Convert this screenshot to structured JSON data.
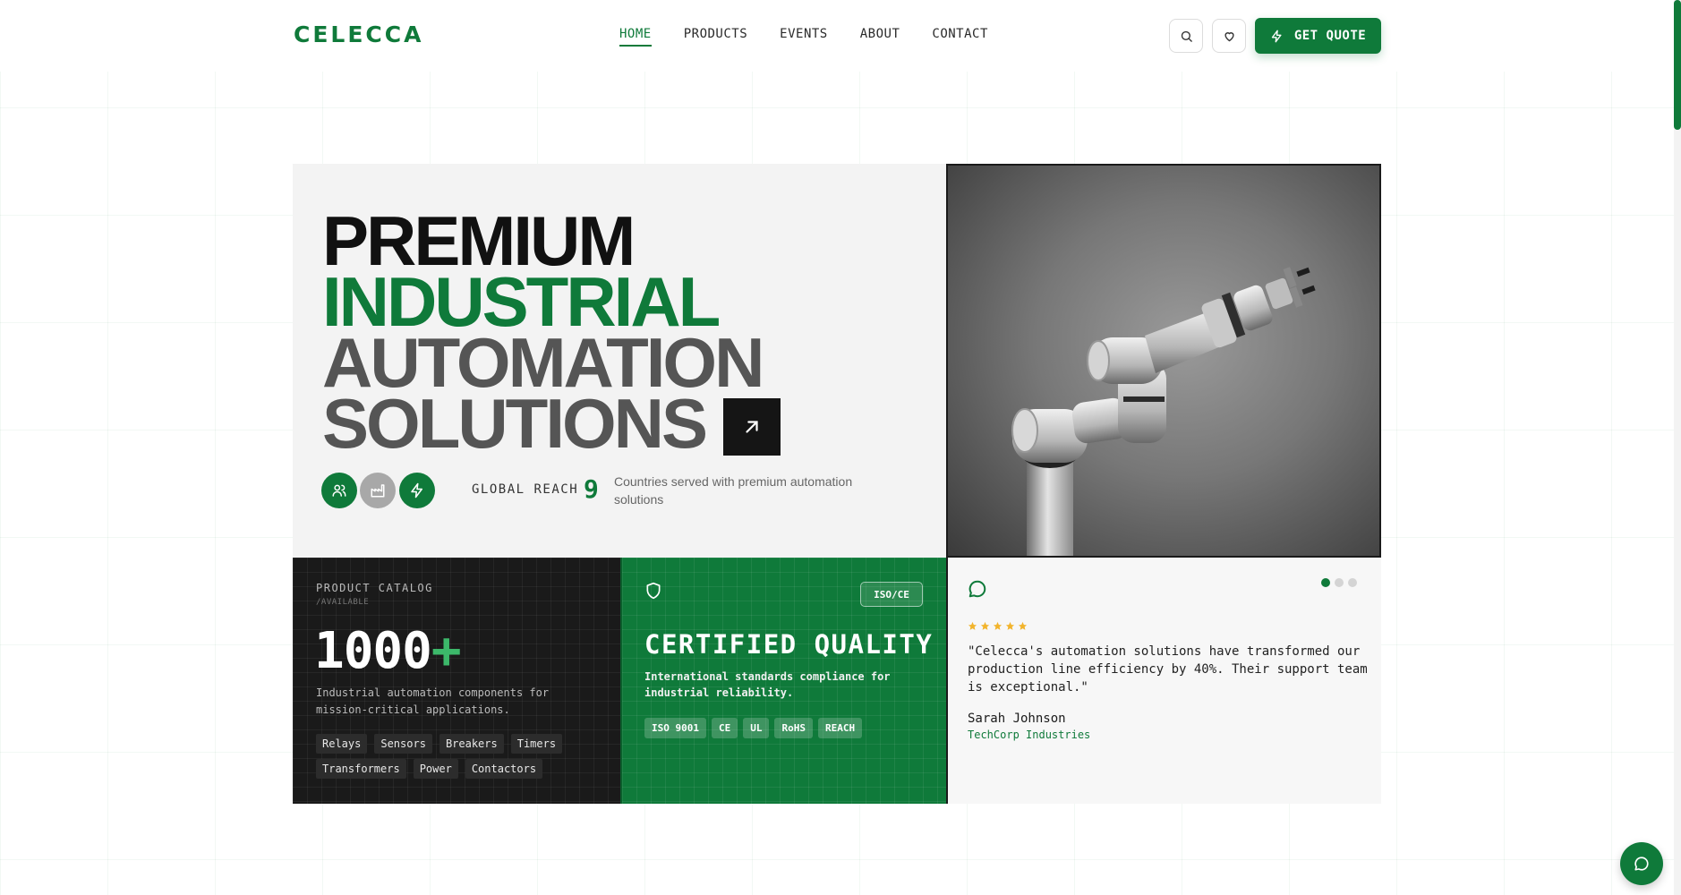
{
  "brand": {
    "logo": "CELECCA",
    "accent_color": "#0f7a3a"
  },
  "nav": {
    "items": [
      {
        "label": "HOME",
        "active": true
      },
      {
        "label": "PRODUCTS",
        "active": false
      },
      {
        "label": "EVENTS",
        "active": false
      },
      {
        "label": "ABOUT",
        "active": false
      },
      {
        "label": "CONTACT",
        "active": false
      }
    ],
    "search_icon": "search-icon",
    "wishlist_icon": "heart-icon",
    "quote_button": {
      "label": "GET QUOTE",
      "icon": "bolt-icon"
    }
  },
  "hero": {
    "headline": [
      "PREMIUM",
      "INDUSTRIAL",
      "AUTOMATION",
      "SOLUTIONS"
    ],
    "arrow_icon": "arrow-up-right-icon",
    "feature_icons": [
      "users-icon",
      "factory-icon",
      "bolt-icon"
    ],
    "reach_label": "GLOBAL REACH",
    "reach_number": "9",
    "reach_description": "Countries served with premium automation solutions",
    "image_subject": "robotic-arm-photo"
  },
  "catalog_card": {
    "label": "PRODUCT CATALOG",
    "sublabel": "/AVAILABLE",
    "count": "1000",
    "count_suffix": "+",
    "description": "Industrial automation components for mission-critical applications.",
    "tags": [
      "Relays",
      "Sensors",
      "Breakers",
      "Timers",
      "Transformers",
      "Power",
      "Contactors"
    ]
  },
  "quality_card": {
    "badge": "ISO/CE",
    "icon": "shield-icon",
    "title": "CERTIFIED QUALITY",
    "description": "International standards compliance for industrial reliability.",
    "certifications": [
      "ISO 9001",
      "CE",
      "UL",
      "RoHS",
      "REACH"
    ]
  },
  "testimonial": {
    "icon": "chat-bubble-icon",
    "rating": 5,
    "quote": "\"Celecca's automation solutions have transformed our production line efficiency by 40%. Their support team is exceptional.\"",
    "author": "Sarah Johnson",
    "company": "TechCorp Industries",
    "slides_total": 3,
    "slide_active": 1
  },
  "chat_widget": {
    "icon": "chat-icon"
  }
}
